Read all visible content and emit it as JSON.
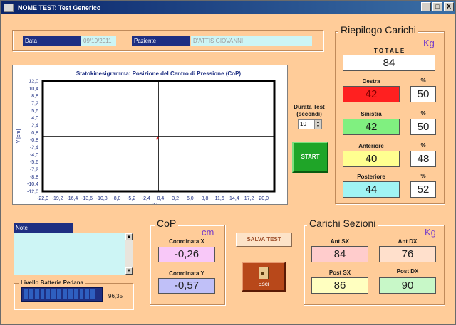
{
  "window": {
    "title": "NOME TEST: Test Generico",
    "min": "_",
    "max": "□",
    "close": "X"
  },
  "header": {
    "data_label": "Data",
    "data_value": "09/10/2011",
    "paziente_label": "Paziente",
    "paziente_value": "D'ATTIS GIOVANNI"
  },
  "chart_data": {
    "type": "line",
    "title": "Statokinesigramma: Posizione del Centro di Pressione (CoP)",
    "xlabel": "X [cm]",
    "ylabel": "Y [cm]",
    "xlim": [
      -22.0,
      22.0
    ],
    "ylim": [
      -12.0,
      12.0
    ],
    "xticks": [
      "-22,0",
      "-19,2",
      "-16,4",
      "-13,6",
      "-10,8",
      "-8,0",
      "-5,2",
      "-2,4",
      "0,4",
      "3,2",
      "6,0",
      "8,8",
      "11,6",
      "14,4",
      "17,2",
      "20,0"
    ],
    "yticks": [
      "12,0",
      "10,4",
      "8,8",
      "7,2",
      "5,6",
      "4,0",
      "2,4",
      "0,8",
      "-0,8",
      "-2,4",
      "-4,0",
      "-5,6",
      "-7,2",
      "-8,8",
      "-10,4",
      "-12,0"
    ],
    "grid": false,
    "series": [
      {
        "x": [
          -0.1,
          -0.2,
          -0.3,
          -0.26,
          -0.35,
          -0.28,
          -0.22
        ],
        "y": [
          -0.2,
          -0.4,
          -0.6,
          -0.57,
          -0.75,
          -0.65,
          -0.5
        ]
      }
    ],
    "color": "#e02020"
  },
  "durata": {
    "label": "Durata Test (secondi)",
    "value": "10"
  },
  "start_label": "START",
  "riepilogo": {
    "title": "Riepilogo Carichi",
    "unit": "Kg",
    "totale_label": "T O T A L E",
    "totale_value": "84",
    "pct_symbol": "%",
    "rows": [
      {
        "label": "Destra",
        "value": "42",
        "pct": "50",
        "color": "#ff2020",
        "text_color": "#800000"
      },
      {
        "label": "Sinistra",
        "value": "42",
        "pct": "50",
        "color": "#80f080",
        "text_color": "#1a1a1a"
      },
      {
        "label": "Anteriore",
        "value": "40",
        "pct": "48",
        "color": "#ffff90",
        "text_color": "#1a1a1a"
      },
      {
        "label": "Posteriore",
        "value": "44",
        "pct": "52",
        "color": "#a0f4f4",
        "text_color": "#1a1a1a"
      }
    ]
  },
  "note": {
    "label": "Note"
  },
  "batteria": {
    "label": "Livello Batterie Pedana",
    "value": "96,35",
    "level_pct": 96.35
  },
  "cop": {
    "title": "CoP",
    "unit": "cm",
    "x_label": "Coordinata X",
    "x_value": "-0,26",
    "x_color": "#f8c8f8",
    "y_label": "Coordinata Y",
    "y_value": "-0,57",
    "y_color": "#c0c0f8"
  },
  "salva_label": "SALVA TEST",
  "esci_label": "Esci",
  "sezioni": {
    "title": "Carichi Sezioni",
    "unit": "Kg",
    "ant_sx_label": "Ant SX",
    "ant_sx_value": "84",
    "ant_sx_color": "#ffcccc",
    "ant_dx_label": "Ant DX",
    "ant_dx_value": "76",
    "ant_dx_color": "#ffe0cc",
    "post_sx_label": "Post SX",
    "post_sx_value": "86",
    "post_sx_color": "#ffffc0",
    "post_dx_label": "Post DX",
    "post_dx_value": "90",
    "post_dx_color": "#c8f8c8"
  }
}
